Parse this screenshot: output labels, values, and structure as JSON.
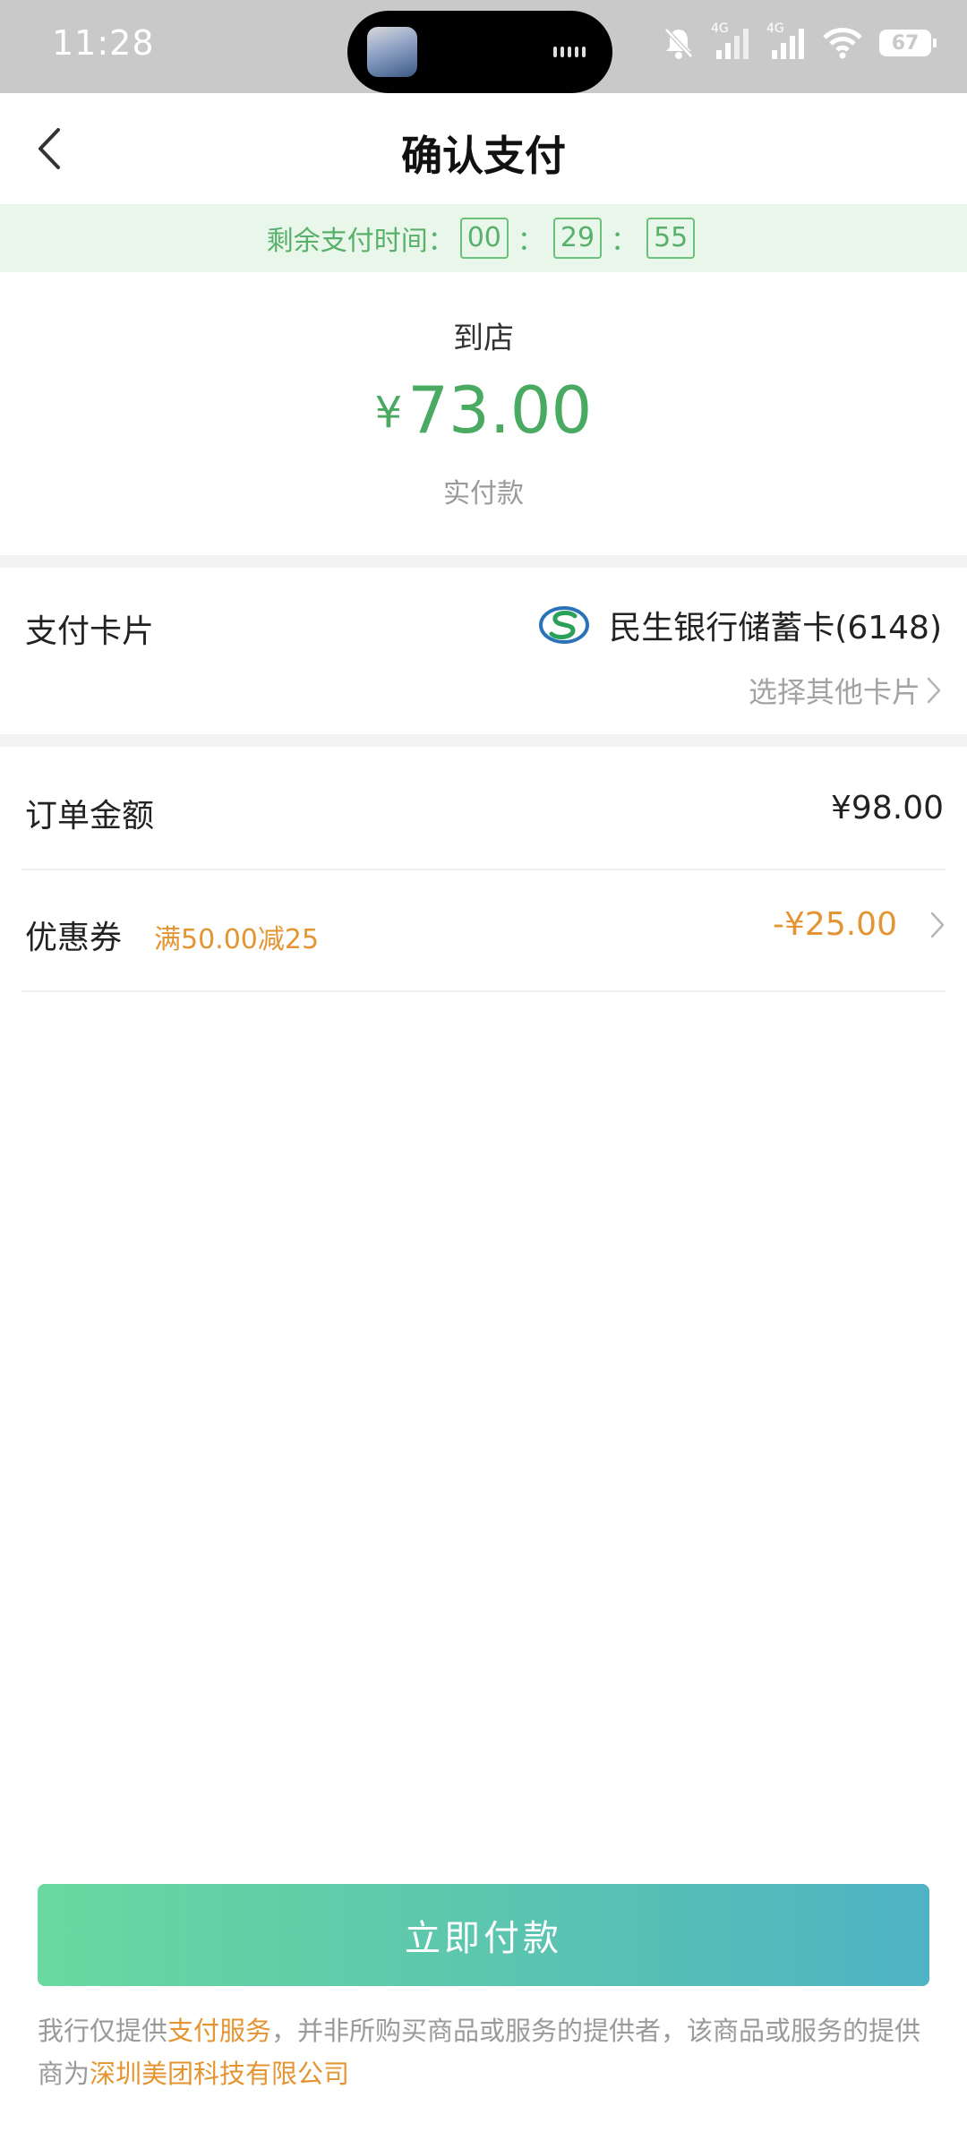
{
  "status_bar": {
    "time": "11:28",
    "network_1": "4G",
    "network_2": "4G",
    "battery": "67"
  },
  "nav": {
    "title": "确认支付"
  },
  "countdown": {
    "label": "剩余支付时间：",
    "hours": "00",
    "minutes": "29",
    "seconds": "55",
    "separator": "："
  },
  "payment": {
    "merchant": "到店",
    "currency_symbol": "¥",
    "amount": "73.00",
    "amount_label": "实付款"
  },
  "card": {
    "label": "支付卡片",
    "bank_name": "民生银行储蓄卡(6148)",
    "bank_icon": "minsheng-bank-icon",
    "choose_other": "选择其他卡片"
  },
  "order": {
    "label": "订单金额",
    "value": "¥98.00"
  },
  "coupon": {
    "label": "优惠券",
    "tag": "满50.00减25",
    "value": "-¥25.00"
  },
  "pay_button": {
    "label": "立即付款"
  },
  "disclaimer": {
    "part1": "我行仅提供",
    "link1": "支付服务",
    "part2": "，并非所购买商品或服务的提供者，该商品或服务的提供商为",
    "link2": "深圳美团科技有限公司"
  },
  "colors": {
    "accent_green": "#4aaa62",
    "accent_orange": "#e49533",
    "countdown_bg": "#e9f6ea"
  }
}
